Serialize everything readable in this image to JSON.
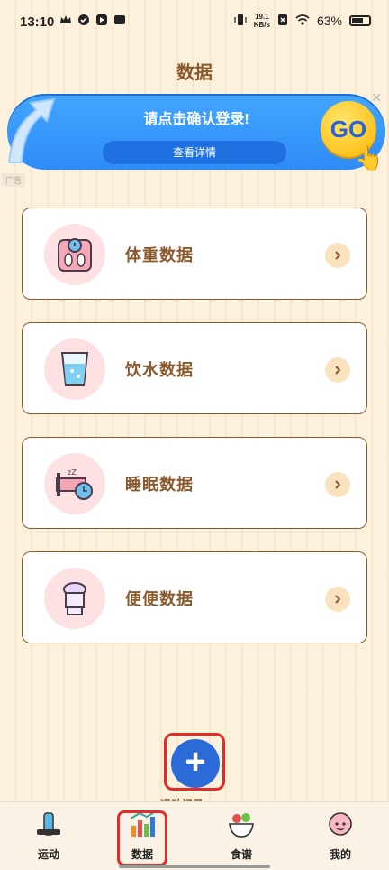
{
  "status_bar": {
    "time": "13:10",
    "net_speed_value": "19.1",
    "net_speed_unit": "KB/s",
    "battery": "63%"
  },
  "page": {
    "title": "数据"
  },
  "banner": {
    "text": "请点击确认登录!",
    "button": "查看详情",
    "go": "GO",
    "ad_label": "广告"
  },
  "cards": [
    {
      "label": "体重数据",
      "icon": "scale-icon"
    },
    {
      "label": "饮水数据",
      "icon": "water-glass-icon"
    },
    {
      "label": "睡眠数据",
      "icon": "sleep-bed-icon"
    },
    {
      "label": "便便数据",
      "icon": "toilet-icon"
    }
  ],
  "fab": {
    "label_partial": "运动记录"
  },
  "nav": {
    "items": [
      {
        "label": "运动",
        "icon": "fitness-icon"
      },
      {
        "label": "数据",
        "icon": "chart-icon"
      },
      {
        "label": "食谱",
        "icon": "food-bowl-icon"
      },
      {
        "label": "我的",
        "icon": "avatar-icon"
      }
    ],
    "active": "数据"
  },
  "colors": {
    "accent_brown": "#8a5a2c",
    "fab_blue": "#2a6bd8",
    "highlight_red": "#e32b2b",
    "banner_blue": "#43a6ff"
  }
}
